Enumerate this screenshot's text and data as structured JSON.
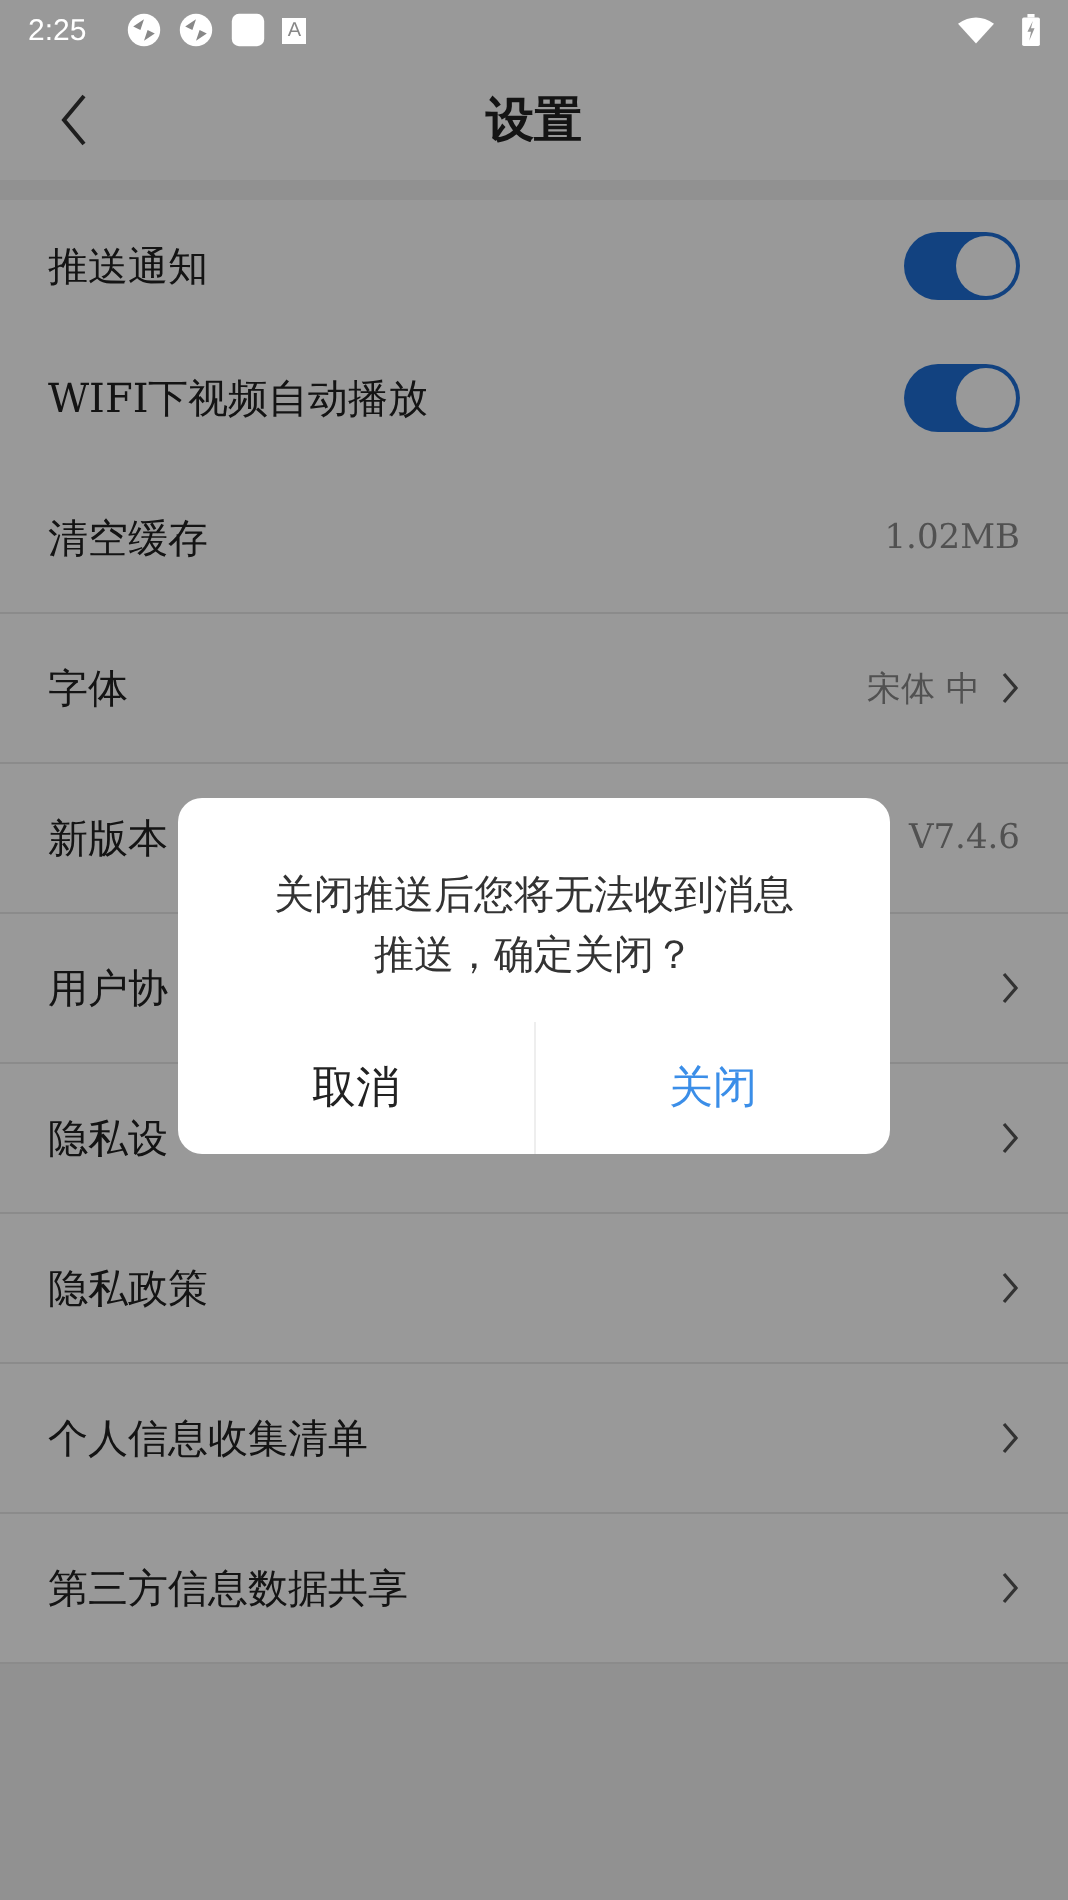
{
  "status_bar": {
    "time": "2:25",
    "badge_letter": "A"
  },
  "header": {
    "title": "设置"
  },
  "settings": [
    {
      "kind": "toggle",
      "label": "推送通知",
      "on": true
    },
    {
      "kind": "toggle",
      "label": "WIFI下视频自动播放",
      "on": true
    },
    {
      "kind": "value",
      "label": "清空缓存",
      "value": "1.02MB"
    },
    {
      "kind": "value_arrow",
      "label": "字体",
      "value": "宋体 中"
    },
    {
      "kind": "value",
      "label": "新版本",
      "value": "V7.4.6"
    },
    {
      "kind": "arrow",
      "label": "用户协"
    },
    {
      "kind": "arrow",
      "label": "隐私设"
    },
    {
      "kind": "arrow",
      "label": "隐私政策"
    },
    {
      "kind": "arrow",
      "label": "个人信息收集清单"
    },
    {
      "kind": "arrow",
      "label": "第三方信息数据共享"
    }
  ],
  "dialog": {
    "message": "关闭推送后您将无法收到消息推送，确定关闭？",
    "buttons": [
      {
        "label": "取消",
        "primary": false
      },
      {
        "label": "关闭",
        "primary": true
      }
    ]
  }
}
